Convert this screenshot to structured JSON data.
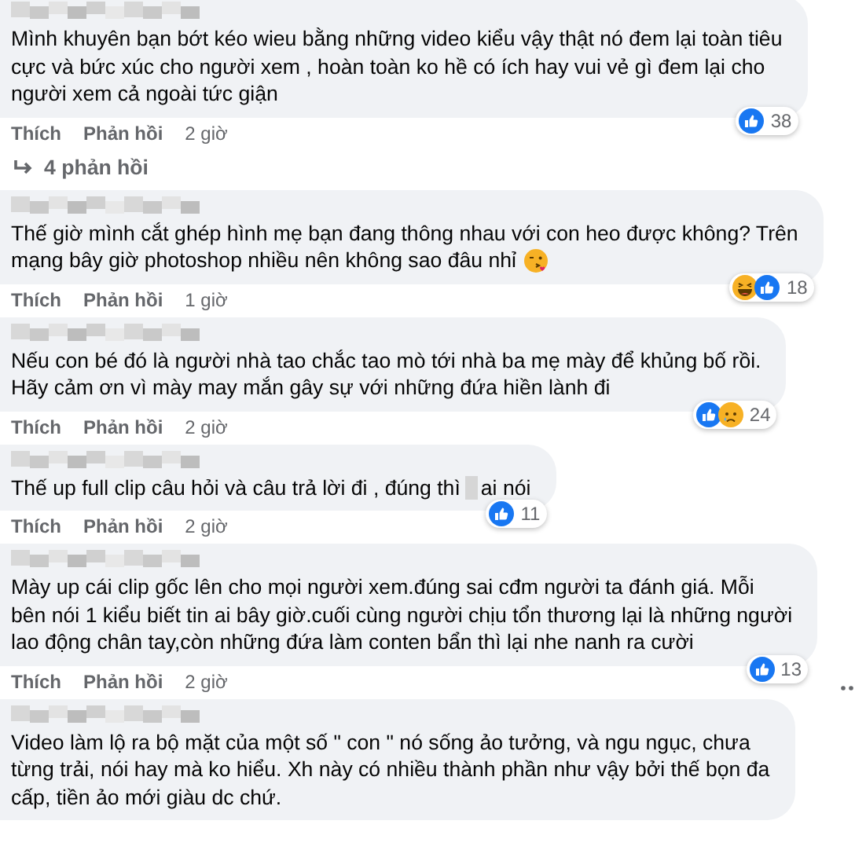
{
  "comments": [
    {
      "lines": [
        "Mình khuyên bạn bớt kéo wieu bằng những video kiểu vậy thật nó đem lại toàn tiêu",
        "cực và bức xúc cho người xem , hoàn toàn ko hề có ích hay vui vẻ gì đem lại cho",
        "người xem cả ngoài tức giận"
      ],
      "reactions": [
        {
          "kind": "like"
        }
      ],
      "reaction_count": "38",
      "like": "Thích",
      "reply": "Phản hồi",
      "time": "2 giờ",
      "replies_link": "4 phản hồi"
    },
    {
      "lines": [
        "Thế giờ mình cắt ghép hình mẹ bạn đang thông nhau với con heo được không? Trên",
        "mạng bây giờ photoshop nhiều nên không sao đâu nhỉ"
      ],
      "emoji": {
        "kind": "kiss"
      },
      "reactions": [
        {
          "kind": "haha"
        },
        {
          "kind": "like"
        }
      ],
      "reaction_count": "18",
      "like": "Thích",
      "reply": "Phản hồi",
      "time": "1 giờ"
    },
    {
      "lines": [
        "Nếu con bé đó là người nhà tao chắc tao mò tới nhà ba mẹ mày để khủng bố rồi.",
        "Hãy cảm ơn vì mày may mắn gây sự với những đứa hiền lành đi"
      ],
      "reactions": [
        {
          "kind": "like"
        },
        {
          "kind": "sad"
        }
      ],
      "reaction_count": "24",
      "like": "Thích",
      "reply": "Phản hồi",
      "time": "2 giờ"
    },
    {
      "lines": [
        "Thế up full clip câu hỏi và câu trả lời đi , đúng thì"
      ],
      "censored_tail": "ai nói",
      "reactions": [
        {
          "kind": "like"
        }
      ],
      "reaction_count": "11",
      "like": "Thích",
      "reply": "Phản hồi",
      "time": "2 giờ"
    },
    {
      "lines": [
        "Mày up cái clip gốc lên cho mọi người xem.đúng sai cđm người ta đánh giá. Mỗi",
        "bên nói 1 kiểu biết tin ai bây giờ.cuối cùng người chịu tổn thương lại là những người",
        "lao động chân tay,còn những đứa làm conten bẩn thì lại nhe nanh ra cười"
      ],
      "reactions": [
        {
          "kind": "like"
        }
      ],
      "reaction_count": "13",
      "like": "Thích",
      "reply": "Phản hồi",
      "time": "2 giờ"
    },
    {
      "lines": [
        "Video làm lộ ra bộ mặt của một số \" con \" nó sống ảo tưởng, và ngu ngục, chưa",
        "từng trải, nói hay mà ko hiểu. Xh này có nhiều thành phần như vậy bởi thế bọn đa",
        "cấp, tiền ảo mới giàu dc chứ."
      ]
    }
  ]
}
